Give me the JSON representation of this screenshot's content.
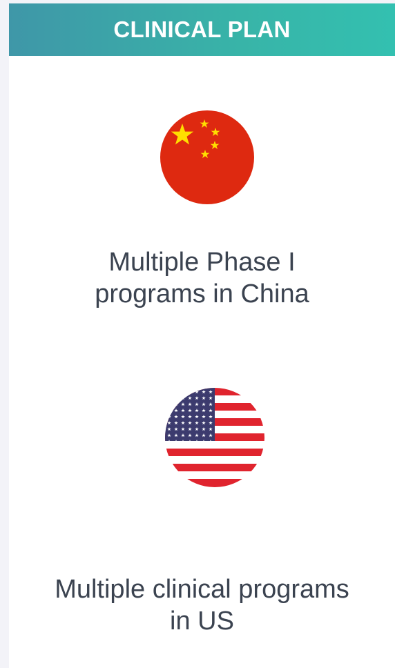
{
  "header": {
    "title": "CLINICAL PLAN"
  },
  "items": [
    {
      "icon": "china-flag-icon",
      "caption_line1": "Multiple Phase I",
      "caption_line2": "programs in China"
    },
    {
      "icon": "us-flag-icon",
      "caption_line1": "Multiple clinical programs",
      "caption_line2": "in US"
    }
  ],
  "colors": {
    "header_gradient_start": "#3f97a8",
    "header_gradient_end": "#33c0b0",
    "text": "#3b4350",
    "china_red": "#de2910",
    "china_star": "#ffde00",
    "us_red": "#e0242e",
    "us_blue": "#3c3b6e"
  }
}
